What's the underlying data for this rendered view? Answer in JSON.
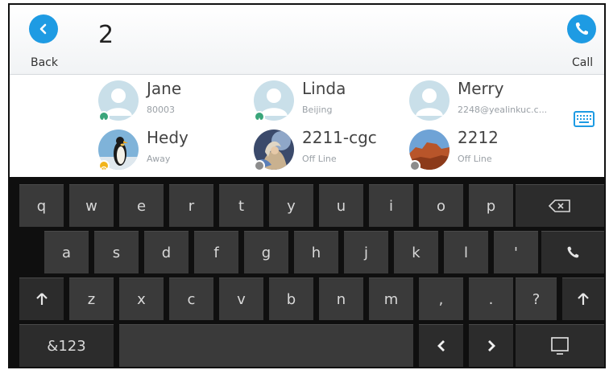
{
  "topbar": {
    "back_label": "Back",
    "call_label": "Call",
    "search_text": "2"
  },
  "contacts": [
    {
      "name": "Jane",
      "sub": "80003",
      "avatar": "default-avatar",
      "status": "star-green",
      "status_color": "#3aa57a"
    },
    {
      "name": "Linda",
      "sub": "Beijing",
      "avatar": "default-avatar",
      "status": "star-green",
      "status_color": "#3aa57a"
    },
    {
      "name": "Merry",
      "sub": "2248@yealinkuc.c...",
      "avatar": "default-avatar",
      "status": "none",
      "status_color": ""
    },
    {
      "name": "Hedy",
      "sub": "Away",
      "avatar": "penguin-photo",
      "status": "away-clock",
      "status_color": "#f2b51c"
    },
    {
      "name": "2211-cgc",
      "sub": "Off Line",
      "avatar": "fantasy-photo",
      "status": "offline",
      "status_color": "#8c8c8c"
    },
    {
      "name": "2212",
      "sub": "Off Line",
      "avatar": "canyon-photo",
      "status": "offline",
      "status_color": "#8c8c8c"
    }
  ],
  "keyboard": {
    "row1": [
      "q",
      "w",
      "e",
      "r",
      "t",
      "y",
      "u",
      "i",
      "o",
      "p"
    ],
    "row2": [
      "a",
      "s",
      "d",
      "f",
      "g",
      "h",
      "j",
      "k",
      "l",
      "'"
    ],
    "row3": [
      "z",
      "x",
      "c",
      "v",
      "b",
      "n",
      "m",
      ",",
      ".",
      "?"
    ],
    "symbols_label": "&123"
  },
  "colors": {
    "accent": "#1e9be3",
    "key": "#3a3a3a",
    "keyboard_bg": "#0f0f0f"
  }
}
